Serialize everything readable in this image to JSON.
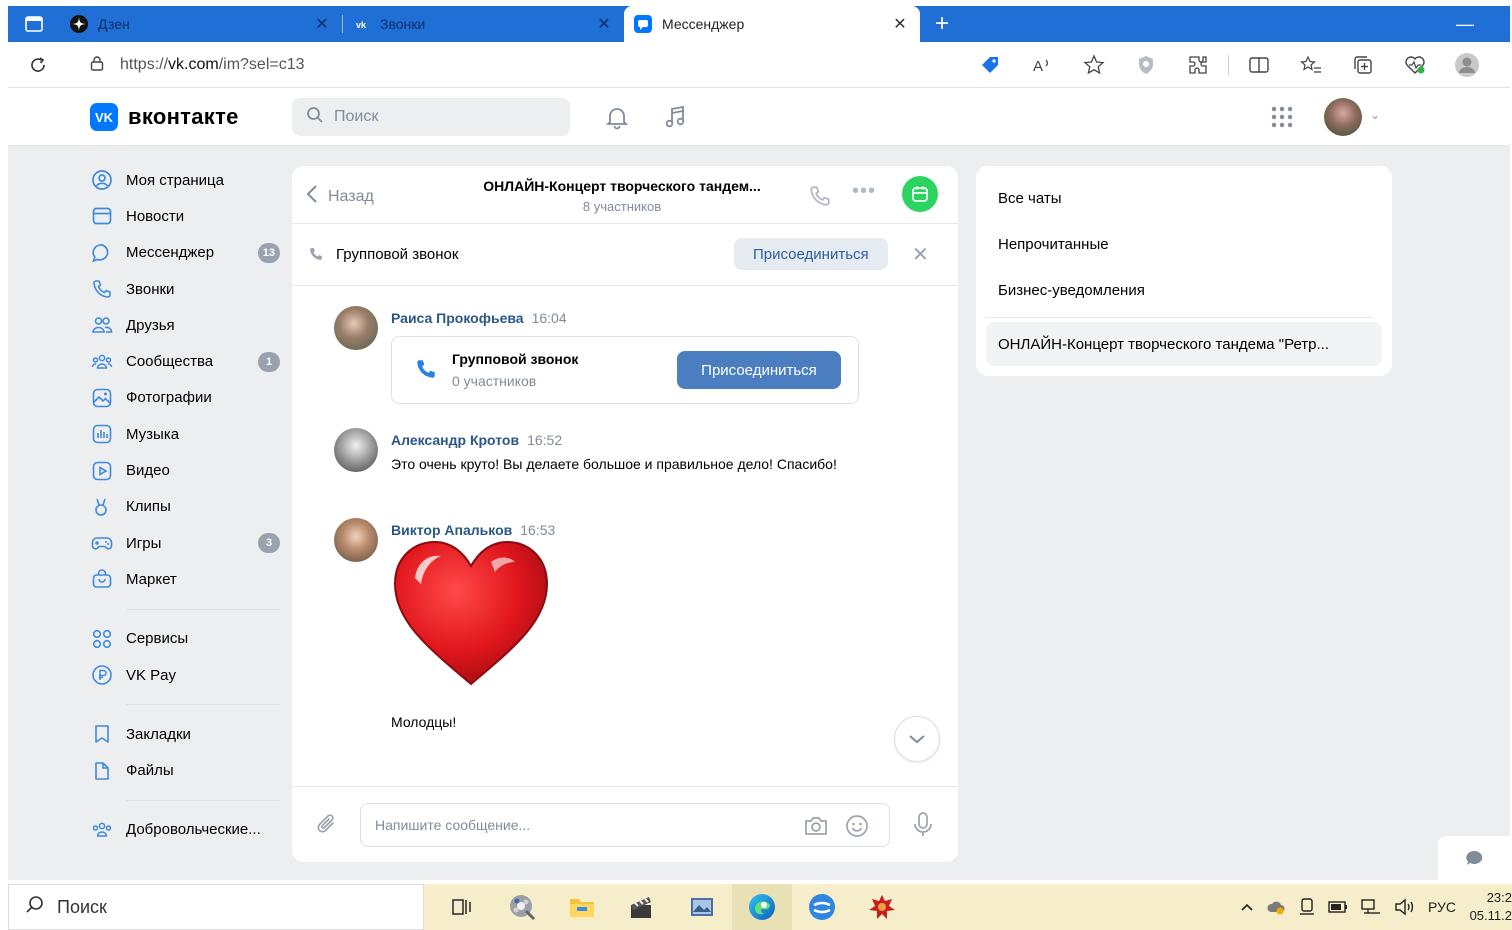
{
  "browser": {
    "tabs": [
      {
        "title": "Дзен",
        "icon": "dzen-icon"
      },
      {
        "title": "Звонки",
        "icon": "vk-icon"
      },
      {
        "title": "Мессенджер",
        "icon": "messenger-icon",
        "active": true
      }
    ],
    "url_prefix": "https://",
    "url_domain": "vk.com",
    "url_path": "/im?sel=c13"
  },
  "vk": {
    "brand": "вконтакте",
    "logo_mark": "VK",
    "search_placeholder": "Поиск"
  },
  "sidebar": {
    "items": [
      {
        "label": "Моя страница",
        "icon": "user-icon"
      },
      {
        "label": "Новости",
        "icon": "news-icon"
      },
      {
        "label": "Мессенджер",
        "icon": "chat-icon",
        "badge": "13"
      },
      {
        "label": "Звонки",
        "icon": "phone-icon"
      },
      {
        "label": "Друзья",
        "icon": "friends-icon"
      },
      {
        "label": "Сообщества",
        "icon": "communities-icon",
        "badge": "1"
      },
      {
        "label": "Фотографии",
        "icon": "photo-icon"
      },
      {
        "label": "Музыка",
        "icon": "music-icon"
      },
      {
        "label": "Видео",
        "icon": "video-icon"
      },
      {
        "label": "Клипы",
        "icon": "clips-icon"
      },
      {
        "label": "Игры",
        "icon": "games-icon",
        "badge": "3"
      },
      {
        "label": "Маркет",
        "icon": "market-icon"
      }
    ],
    "group2": [
      {
        "label": "Сервисы",
        "icon": "services-icon"
      },
      {
        "label": "VK Pay",
        "icon": "vkpay-icon"
      }
    ],
    "group3": [
      {
        "label": "Закладки",
        "icon": "bookmark-icon"
      },
      {
        "label": "Файлы",
        "icon": "file-icon"
      }
    ],
    "group4": [
      {
        "label": "Добровольческие...",
        "icon": "volunteer-icon"
      }
    ]
  },
  "chat": {
    "back_label": "Назад",
    "title": "ОНЛАЙН-Концерт творческого тандем...",
    "subtitle": "8 участников",
    "call_bar_text": "Групповой звонок",
    "call_bar_join": "Присоединиться",
    "messages": [
      {
        "author": "Раиса Прокофьева",
        "time": "16:04",
        "call_card": {
          "title": "Групповой звонок",
          "participants": "0 участников",
          "join": "Присоединиться"
        }
      },
      {
        "author": "Александр Кротов",
        "time": "16:52",
        "text": "Это очень круто! Вы делаете большое и правильное дело! Спасибо!"
      },
      {
        "author": "Виктор Апальков",
        "time": "16:53",
        "sticker": "heart-sticker",
        "text": "Молодцы!"
      }
    ],
    "composer_placeholder": "Напишите сообщение..."
  },
  "folders": {
    "items": [
      "Все чаты",
      "Непрочитанные",
      "Бизнес-уведомления"
    ],
    "active_chat": "ОНЛАЙН-Концерт творческого тандема \"Ретр..."
  },
  "taskbar": {
    "search_label": "Поиск",
    "lang": "РУС",
    "time": "23:2",
    "date": "05.11.2"
  },
  "colors": {
    "vk_blue": "#0077ff",
    "link_blue": "#2a5885",
    "join_blue": "#4a7ec0",
    "green": "#2bd460",
    "bg": "#edeef0"
  }
}
